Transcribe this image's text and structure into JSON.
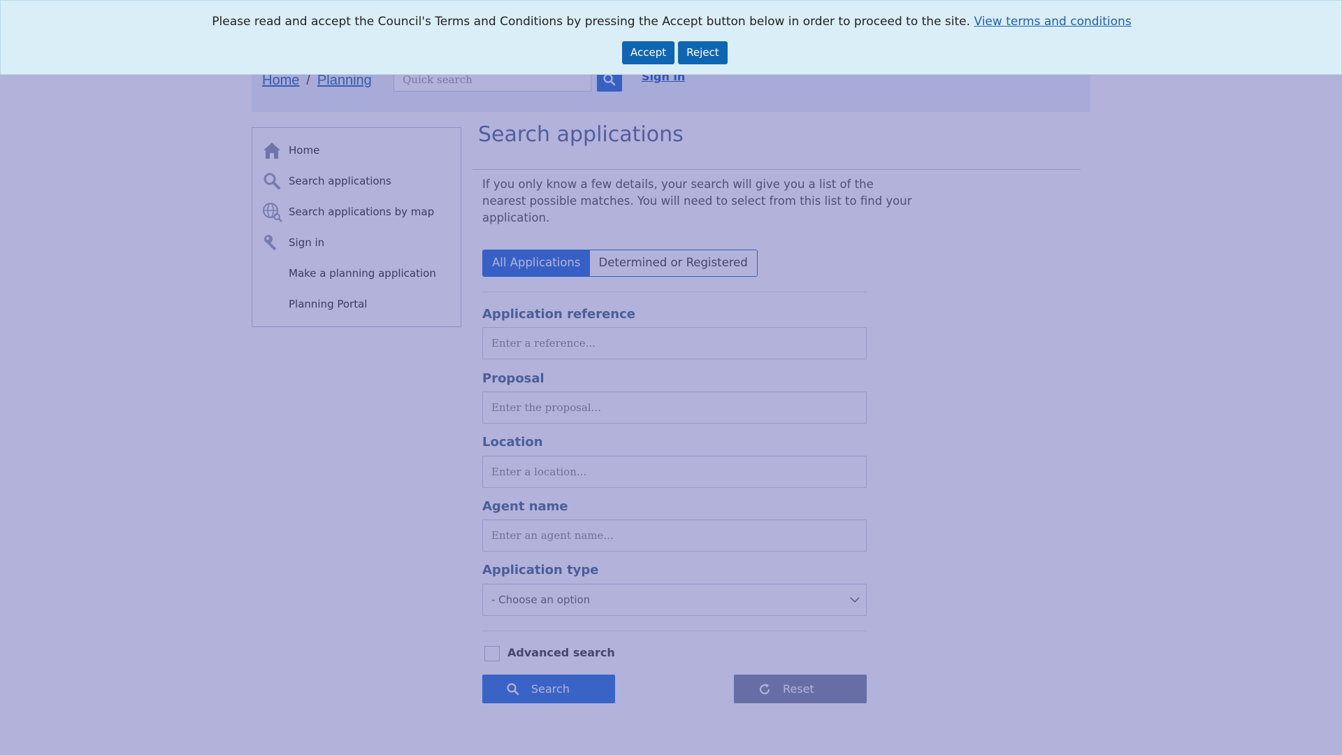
{
  "banner": {
    "text": "Please read and accept the Council's Terms and Conditions by pressing the Accept button below in order to proceed to the site.",
    "link": "View terms and conditions",
    "accept": "Accept",
    "reject": "Reject"
  },
  "header": {
    "breadcrumb_home": "Home",
    "breadcrumb_sep": "/",
    "breadcrumb_planning": "Planning",
    "quick_search_placeholder": "Quick search",
    "sign_in": "Sign in"
  },
  "nav": {
    "items": [
      {
        "label": "Home",
        "icon": "house-icon"
      },
      {
        "label": "Search applications",
        "icon": "magnifier-icon"
      },
      {
        "label": "Search applications by map",
        "icon": "globe-search-icon"
      },
      {
        "label": "Sign in",
        "icon": "key-icon"
      },
      {
        "label": "Make a planning application",
        "icon": ""
      },
      {
        "label": "Planning Portal",
        "icon": ""
      }
    ]
  },
  "main": {
    "title": "Search applications",
    "intro": "If you only know a few details, your search will give you a list of the nearest possible matches. You will need to select from this list to find your application.",
    "tabs": [
      {
        "label": "All Applications",
        "active": true
      },
      {
        "label": "Determined or Registered",
        "active": false
      }
    ],
    "fields": {
      "reference": {
        "label": "Application reference",
        "placeholder": "Enter a reference..."
      },
      "proposal": {
        "label": "Proposal",
        "placeholder": "Enter the proposal..."
      },
      "location": {
        "label": "Location",
        "placeholder": "Enter a location..."
      },
      "agent": {
        "label": "Agent name",
        "placeholder": "Enter an agent name..."
      },
      "type": {
        "label": "Application type",
        "value": "- Choose an option"
      }
    },
    "advanced_label": "Advanced search",
    "search_button": "Search",
    "reset_button": "Reset"
  },
  "colors": {
    "overlay": "#4848aa",
    "banner_bg": "#daeef8",
    "button_primary": "#1065b2",
    "accent": "#2b73d8"
  }
}
